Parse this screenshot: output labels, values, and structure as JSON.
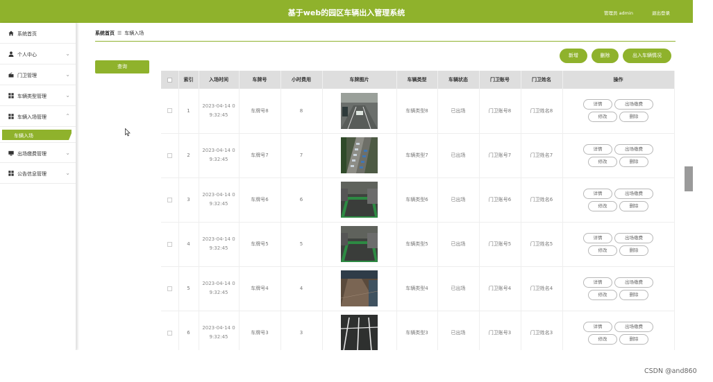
{
  "header": {
    "title": "基于web的园区车辆出入管理系统",
    "user": "管理员 admin",
    "logout": "退出登录"
  },
  "sidebar": {
    "items": [
      {
        "icon": "home-icon",
        "label": "系统首页"
      },
      {
        "icon": "user-icon",
        "label": "个人中心"
      },
      {
        "icon": "guard-icon",
        "label": "门卫管理"
      },
      {
        "icon": "grid-icon",
        "label": "车辆类型管理"
      },
      {
        "icon": "grid-icon",
        "label": "车辆入场管理"
      },
      {
        "icon": "monitor-icon",
        "label": "出场缴费管理"
      },
      {
        "icon": "grid-icon",
        "label": "公告信息管理"
      }
    ],
    "active_sub": "车辆入场"
  },
  "breadcrumb": {
    "home": "系统首页",
    "current": "车辆入场"
  },
  "toolbar": {
    "search": "查询",
    "add": "新增",
    "delete": "删除",
    "status": "出入车辆情况"
  },
  "table": {
    "headers": [
      "索引",
      "入场时间",
      "车牌号",
      "小时费用",
      "车牌图片",
      "车辆类型",
      "车辆状态",
      "门卫账号",
      "门卫姓名",
      "操作"
    ],
    "rows": [
      {
        "index": "1",
        "time1": "2023-04-14 0",
        "time2": "9:32:45",
        "plate": "车牌号8",
        "fee": "8",
        "type": "车辆类型8",
        "status": "已出场",
        "account": "门卫账号8",
        "name": "门卫姓名8",
        "img": "garage"
      },
      {
        "index": "2",
        "time1": "2023-04-14 0",
        "time2": "9:32:45",
        "plate": "车牌号7",
        "fee": "7",
        "type": "车辆类型7",
        "status": "已出场",
        "account": "门卫账号7",
        "name": "门卫姓名7",
        "img": "aerial"
      },
      {
        "index": "3",
        "time1": "2023-04-14 0",
        "time2": "9:32:45",
        "plate": "车牌号6",
        "fee": "6",
        "type": "车辆类型6",
        "status": "已出场",
        "account": "门卫账号6",
        "name": "门卫姓名6",
        "img": "greenspot"
      },
      {
        "index": "4",
        "time1": "2023-04-14 0",
        "time2": "9:32:45",
        "plate": "车牌号5",
        "fee": "5",
        "type": "车辆类型5",
        "status": "已出场",
        "account": "门卫账号5",
        "name": "门卫姓名5",
        "img": "greenspot"
      },
      {
        "index": "5",
        "time1": "2023-04-14 0",
        "time2": "9:32:45",
        "plate": "车牌号4",
        "fee": "4",
        "type": "车辆类型4",
        "status": "已出场",
        "account": "门卫账号4",
        "name": "门卫姓名4",
        "img": "brownfloor"
      },
      {
        "index": "6",
        "time1": "2023-04-14 0",
        "time2": "9:32:45",
        "plate": "车牌号3",
        "fee": "3",
        "type": "车辆类型3",
        "status": "已出场",
        "account": "门卫账号3",
        "name": "门卫姓名3",
        "img": "lines"
      }
    ],
    "ops": {
      "detail": "详情",
      "pay": "出场缴费",
      "edit": "修改",
      "delete": "删除"
    }
  },
  "watermark": "CSDN @and860",
  "colors": {
    "accent": "#8fb22c",
    "header_bg": "#dedede"
  }
}
